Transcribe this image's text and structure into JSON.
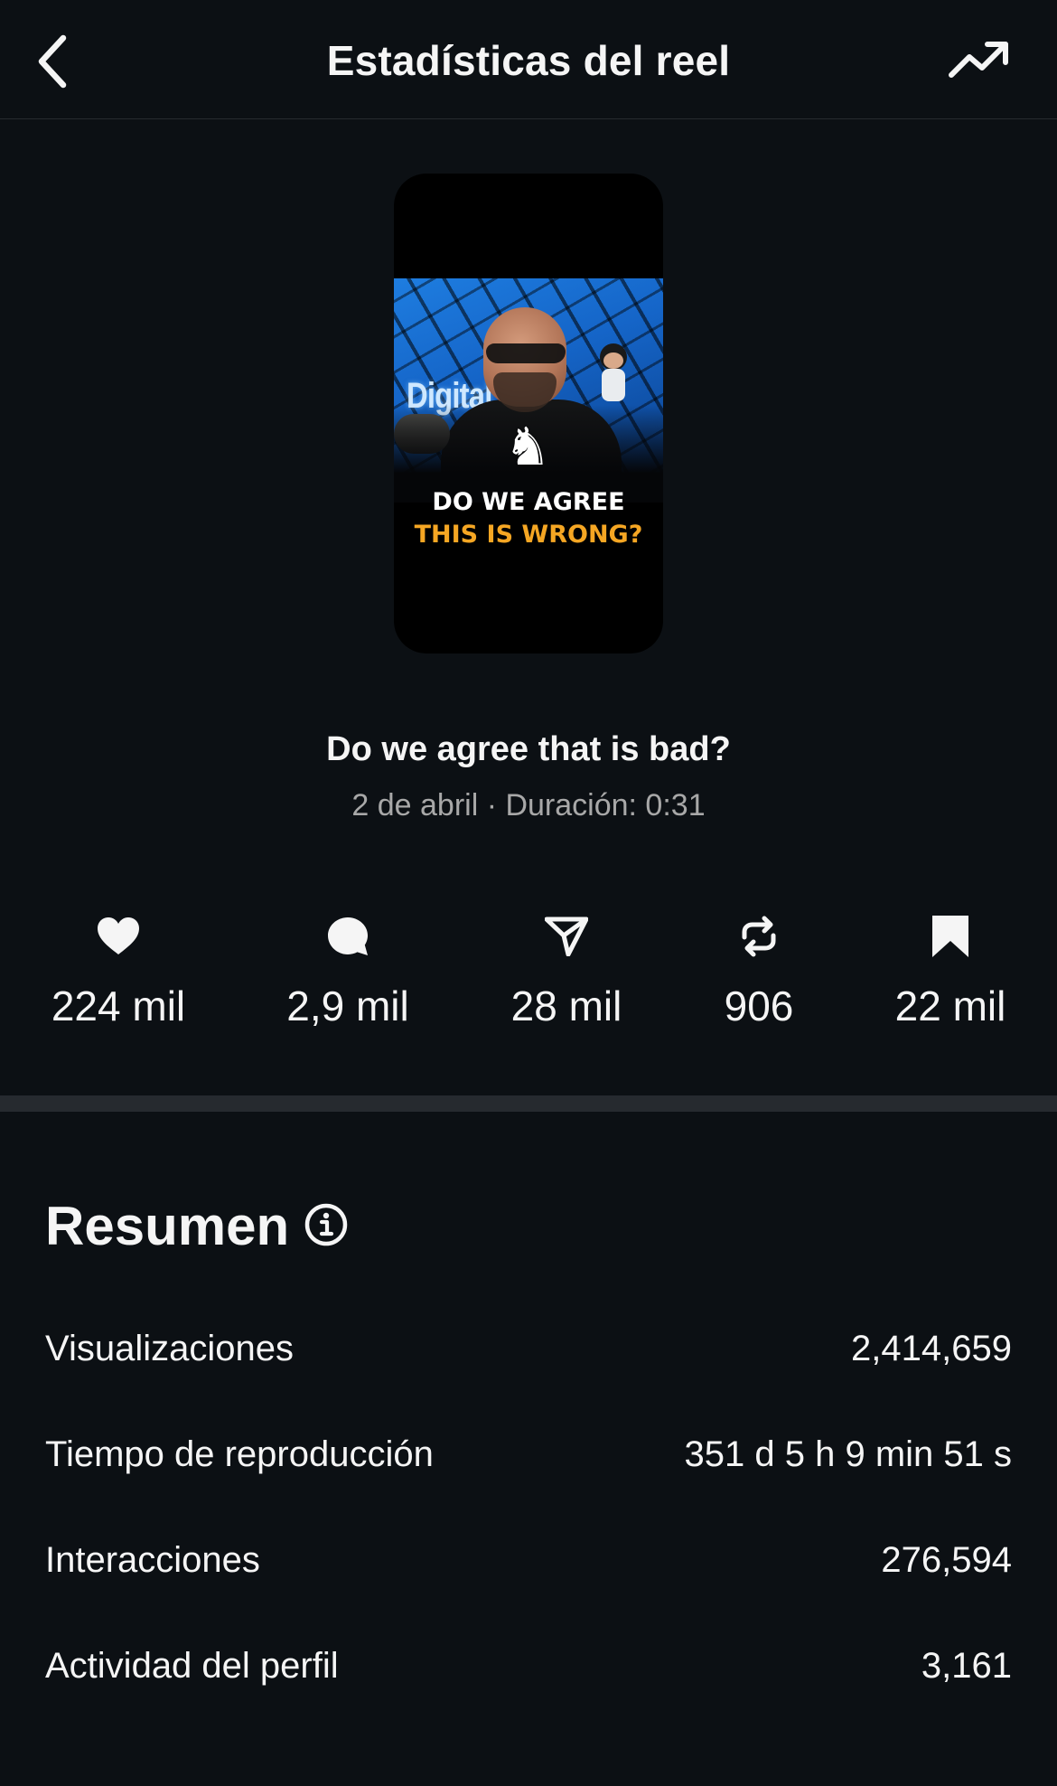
{
  "header": {
    "title": "Estadísticas del reel",
    "back_icon": "chevron-left-icon",
    "trend_icon": "trending-up-icon"
  },
  "thumbnail": {
    "brand_text": "Digital",
    "caption_line1": "DO WE AGREE",
    "caption_line2": "THIS IS WRONG?",
    "caption_accent": "#f5a623"
  },
  "reel": {
    "title": "Do we agree that is bad?",
    "meta": "2 de abril · Duración: 0:31"
  },
  "stats": [
    {
      "icon": "heart-icon",
      "value": "224 mil"
    },
    {
      "icon": "comment-icon",
      "value": "2,9 mil"
    },
    {
      "icon": "send-icon",
      "value": "28 mil"
    },
    {
      "icon": "repost-icon",
      "value": "906"
    },
    {
      "icon": "bookmark-icon",
      "value": "22 mil"
    }
  ],
  "summary": {
    "title": "Resumen",
    "info_icon": "info-icon",
    "rows": [
      {
        "label": "Visualizaciones",
        "value": "2,414,659"
      },
      {
        "label": "Tiempo de reproducción",
        "value": "351 d 5 h 9 min 51 s"
      },
      {
        "label": "Interacciones",
        "value": "276,594"
      },
      {
        "label": "Actividad del perfil",
        "value": "3,161"
      }
    ]
  },
  "colors": {
    "background": "#0c1014",
    "text": "#f5f5f5",
    "muted": "#a8a8a8",
    "divider": "#262a2f"
  }
}
